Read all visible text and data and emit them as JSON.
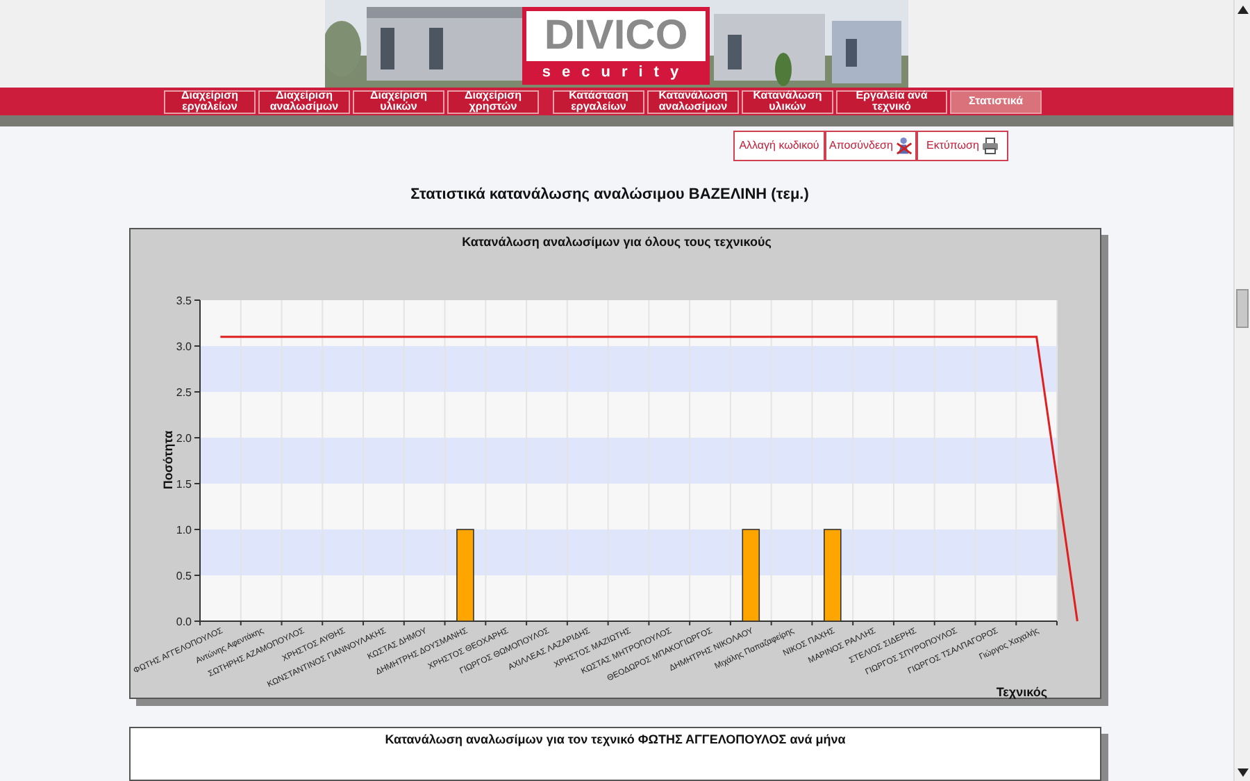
{
  "banner": {
    "logo_title": "DIVICO",
    "logo_subtitle": "security"
  },
  "nav": [
    {
      "label": "Διαχείριση εργαλείων",
      "selected": false
    },
    {
      "label": "Διαχείριση αναλωσίμων",
      "selected": false
    },
    {
      "label": "Διαχείριση υλικών",
      "selected": false
    },
    {
      "label": "Διαχείριση χρηστών",
      "selected": false
    },
    {
      "label": "Κατάσταση εργαλείων",
      "selected": false
    },
    {
      "label": "Κατανάλωση αναλωσίμων",
      "selected": false
    },
    {
      "label": "Κατανάλωση υλικών",
      "selected": false
    },
    {
      "label": "Εργαλεία ανά τεχνικό",
      "selected": false
    },
    {
      "label": "Στατιστικά",
      "selected": true
    }
  ],
  "actions": [
    {
      "label": "Αλλαγή κωδικού",
      "kind": "text"
    },
    {
      "label": "Αποσύνδεση",
      "kind": "logout"
    },
    {
      "label": "Εκτύπωση",
      "kind": "print"
    }
  ],
  "page_title": "Στατιστικά κατανάλωσης αναλώσιμου ΒΑΖΕΛΙΝΗ (τεμ.)",
  "chart": {
    "chart_data": {
      "type": "bar",
      "title": "Κατανάλωση αναλωσίμων για όλους τους τεχνικούς",
      "xlabel": "Τεχνικός",
      "ylabel": "Ποσότητα",
      "categories": [
        "ΦΩΤΗΣ ΑΓΓΕΛΟΠΟΥΛΟΣ",
        "Αντώνης Αφεντάκης",
        "ΣΩΤΗΡΗΣ ΑΖΑΜΟΠΟΥΛΟΣ",
        "ΧΡΗΣΤΟΣ ΑΥΘΗΣ",
        "ΚΩΝΣΤΑΝΤΙΝΟΣ ΓΙΑΝΝΟΥΛΑΚΗΣ",
        "ΚΩΣΤΑΣ ΔΗΜΟΥ",
        "ΔΗΜΗΤΡΗΣ ΔΟΥΣΜΑΝΗΣ",
        "ΧΡΗΣΤΟΣ ΘΕΟΧΑΡΗΣ",
        "ΓΙΩΡΓΟΣ ΘΩΜΟΠΟΥΛΟΣ",
        "ΑΧΙΛΛΕΑΣ ΛΑΖΑΡΙΔΗΣ",
        "ΧΡΗΣΤΟΣ ΜΑΖΙΩΤΗΣ",
        "ΚΩΣΤΑΣ ΜΗΤΡΟΠΟΥΛΟΣ",
        "ΘΕΟΔΩΡΟΣ ΜΠΑΚΟΓΙΩΡΓΟΣ",
        "ΔΗΜΗΤΡΗΣ ΝΙΚΟΛΑΟΥ",
        "Μιχάλης Παπαζαφείρης",
        "ΝΙΚΟΣ ΠΑΧΗΣ",
        "ΜΑΡΙΝΟΣ ΡΑΛΛΗΣ",
        "ΣΤΕΛΙΟΣ ΣΙΔΕΡΗΣ",
        "ΓΙΩΡΓΟΣ ΣΠΥΡΟΠΟΥΛΟΣ",
        "ΓΙΩΡΓΟΣ ΤΣΑΛΠΑΓΟΡΟΣ",
        "Γιώργος Χαχαλής"
      ],
      "series": [
        {
          "type": "bar",
          "color": "#ffa500",
          "values": [
            0,
            0,
            0,
            0,
            0,
            0,
            1,
            0,
            0,
            0,
            0,
            0,
            0,
            1,
            0,
            1,
            0,
            0,
            0,
            0,
            0
          ]
        },
        {
          "type": "line",
          "color": "#e02020",
          "values": [
            3.1,
            3.1,
            3.1,
            3.1,
            3.1,
            3.1,
            3.1,
            3.1,
            3.1,
            3.1,
            3.1,
            3.1,
            3.1,
            3.1,
            3.1,
            3.1,
            3.1,
            3.1,
            3.1,
            3.1,
            3.1
          ]
        }
      ],
      "ylim": [
        0,
        3.5
      ],
      "yticks": [
        {
          "value": 0,
          "label": "0.0"
        },
        0.5,
        {
          "value": 1,
          "label": "1.0"
        },
        1.5,
        {
          "value": 2,
          "label": "2.0"
        },
        2.5,
        {
          "value": 3,
          "label": "3.0"
        },
        3.5
      ]
    },
    "line_drops_to_axis_after_last": true
  },
  "second_panel": {
    "title": "Κατανάλωση αναλωσίμων για τον τεχνικό ΦΩΤΗΣ ΑΓΓΕΛΟΠΟΥΛΟΣ ανά μήνα"
  }
}
